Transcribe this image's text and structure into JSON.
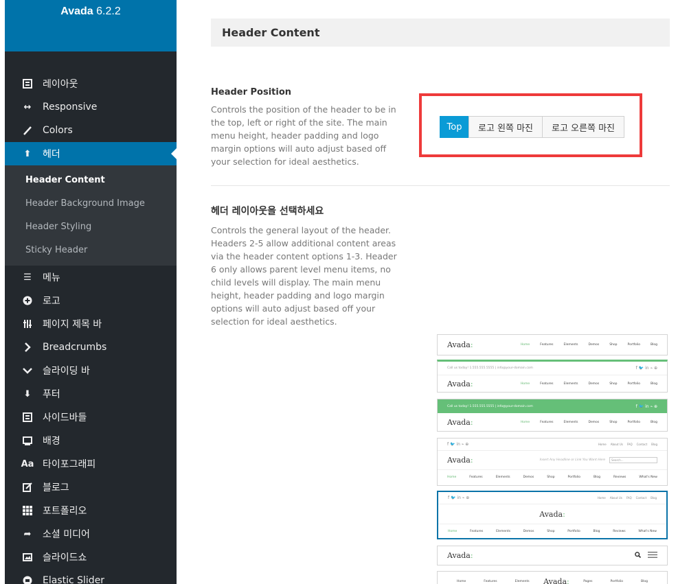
{
  "brand": {
    "name": "Avada",
    "version": "6.2.2"
  },
  "sidebar": {
    "items_top": [
      {
        "icon": "layout-icon",
        "label": "레이아웃"
      },
      {
        "icon": "responsive-arrows-icon",
        "label": "Responsive"
      },
      {
        "icon": "brush-icon",
        "label": "Colors"
      },
      {
        "icon": "arrow-up-icon",
        "label": "헤더"
      }
    ],
    "submenu": [
      "Header Content",
      "Header Background Image",
      "Header Styling",
      "Sticky Header"
    ],
    "items_bottom": [
      {
        "icon": "menu-icon",
        "label": "메뉴"
      },
      {
        "icon": "plus-circle-icon",
        "label": "로고"
      },
      {
        "icon": "sliders-icon",
        "label": "페이지 제목 바"
      },
      {
        "icon": "chevron-right-icon",
        "label": "Breadcrumbs"
      },
      {
        "icon": "chevron-down-icon",
        "label": "슬라이딩 바"
      },
      {
        "icon": "arrow-down-icon",
        "label": "푸터"
      },
      {
        "icon": "sidebar-icon",
        "label": "사이드바들"
      },
      {
        "icon": "monitor-icon",
        "label": "배경"
      },
      {
        "icon": "typography-icon",
        "label": "타이포그래피"
      },
      {
        "icon": "edit-icon",
        "label": "블로그"
      },
      {
        "icon": "grid-icon",
        "label": "포트폴리오"
      },
      {
        "icon": "share-icon",
        "label": "소셜 미디어"
      },
      {
        "icon": "image-icon",
        "label": "슬라이드쇼"
      },
      {
        "icon": "elastic-icon",
        "label": "Elastic Slider"
      }
    ]
  },
  "main": {
    "section_title": "Header Content",
    "header_position": {
      "title": "Header Position",
      "description": "Controls the position of the header to be in the top, left or right of the site. The main menu height, header padding and logo margin options will auto adjust based off your selection for ideal aesthetics.",
      "options": [
        "Top",
        "로고 왼쪽 마진",
        "로고 오른쪽 마진"
      ],
      "selected": "Top"
    },
    "header_layout": {
      "title": "헤더 레이아웃을 선택하세요",
      "description": "Controls the general layout of the header. Headers 2-5 allow additional content areas via the header content options 1-3. Header 6 only allows parent level menu items, no child levels will display. The main menu height, header padding and logo margin options will auto adjust based off your selection for ideal aesthetics."
    },
    "thumbs": {
      "logo_main": "Avada",
      "logo_accent": ":",
      "nav1": [
        "Home",
        "Features",
        "Elements",
        "Demos",
        "Shop",
        "Portfolio",
        "Blog"
      ],
      "nav_wide": [
        "Home",
        "Features",
        "Elements",
        "Demos",
        "Shop",
        "Portfolio",
        "Blog",
        "Reviews",
        "What's New"
      ],
      "top_links": [
        "Home",
        "About Us",
        "FAQ",
        "Contact",
        "Blog"
      ],
      "contact_text": "Call us today!  1.555.555.5555   |   info@your-domain.com",
      "tagline": "Insert Any Headline or Link You Want Here",
      "search_placeholder": "Search...",
      "nav_split_left": [
        "Home",
        "Features",
        "Elements"
      ],
      "nav_split_right": [
        "Pages",
        "Portfolio",
        "Blog"
      ]
    }
  },
  "colors": {
    "accent": "#0073aa",
    "selected_btn": "#0a9bd6",
    "highlight": "#ee3a3a",
    "green": "#65bf78"
  }
}
